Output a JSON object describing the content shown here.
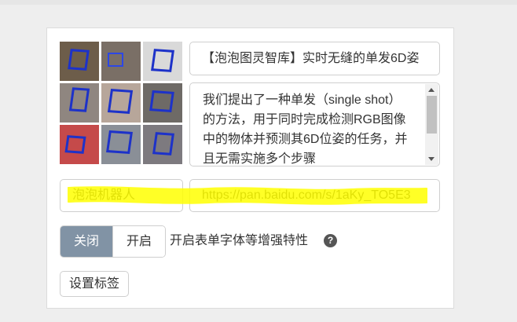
{
  "form": {
    "title_value": "【泡泡图灵智库】实时无缝的单发6D姿",
    "description_value": "我们提出了一种单发（single shot）的方法，用于同时完成检测RGB图像中的物体并预测其6D位姿的任务，并且无需实施多个步骤",
    "name_value": "泡泡机器人",
    "url_value": "https://pan.baidu.com/s/1aKy_TO5E3",
    "toggle": {
      "off_label": "关闭",
      "on_label": "开启",
      "selected": "关闭",
      "description": "开启表单字体等增强特性"
    },
    "help_icon": "question-circle-icon",
    "tag_button_label": "设置标签"
  },
  "colors": {
    "toggle_active": "#8193a5",
    "highlight": "#ffff00",
    "cube_outline": "#1d32c9"
  }
}
